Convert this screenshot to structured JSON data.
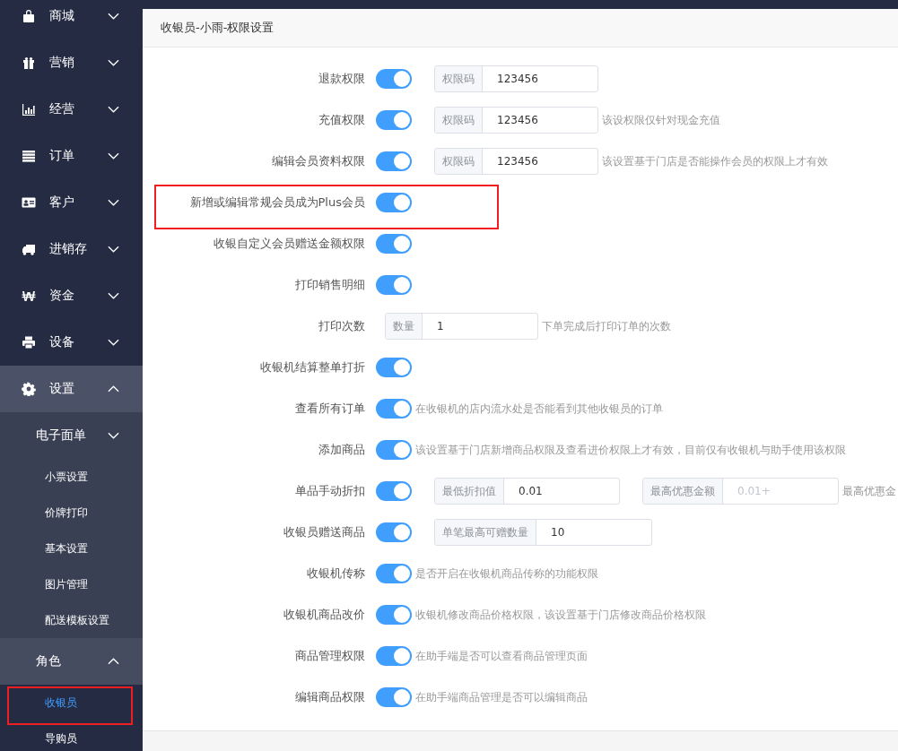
{
  "sidebar": {
    "items": [
      {
        "label": "商城",
        "expanded": false
      },
      {
        "label": "营销",
        "expanded": false
      },
      {
        "label": "经营",
        "expanded": false
      },
      {
        "label": "订单",
        "expanded": false
      },
      {
        "label": "客户",
        "expanded": false
      },
      {
        "label": "进销存",
        "expanded": false
      },
      {
        "label": "资金",
        "expanded": false
      },
      {
        "label": "设备",
        "expanded": false
      },
      {
        "label": "设置",
        "expanded": true,
        "children": [
          {
            "label": "电子面单",
            "expanded": false
          },
          {
            "label": "小票设置",
            "selected": false,
            "highlighted": false
          },
          {
            "label": "价牌打印",
            "selected": false,
            "highlighted": false
          },
          {
            "label": "基本设置",
            "selected": false,
            "highlighted": false
          },
          {
            "label": "图片管理",
            "selected": false,
            "highlighted": false
          },
          {
            "label": "配送模板设置",
            "selected": false,
            "highlighted": false
          },
          {
            "label": "角色",
            "expanded": true,
            "children": [
              {
                "label": "收银员",
                "selected": true,
                "highlighted": true
              },
              {
                "label": "导购员",
                "selected": false,
                "highlighted": false
              }
            ]
          }
        ]
      }
    ]
  },
  "header": {
    "title": "收银员-小雨-权限设置"
  },
  "rows": [
    {
      "kind": "switch",
      "label": "退款权限",
      "on": true,
      "highlighted": false,
      "inputs": [
        {
          "prefix": "权限码",
          "value": "123456"
        }
      ]
    },
    {
      "kind": "switch",
      "label": "充值权限",
      "on": true,
      "highlighted": false,
      "inputs": [
        {
          "prefix": "权限码",
          "value": "123456"
        }
      ],
      "hint": "该设权限仅针对现金充值"
    },
    {
      "kind": "switch",
      "label": "编辑会员资料权限",
      "on": true,
      "highlighted": false,
      "inputs": [
        {
          "prefix": "权限码",
          "value": "123456"
        }
      ],
      "hint": "该设置基于门店是否能操作会员的权限上才有效"
    },
    {
      "kind": "switch",
      "label": "新增或编辑常规会员成为Plus会员",
      "on": true,
      "highlighted": true
    },
    {
      "kind": "switch",
      "label": "收银自定义会员赠送金额权限",
      "on": true,
      "highlighted": false
    },
    {
      "kind": "switch",
      "label": "打印销售明细",
      "on": true,
      "highlighted": false
    },
    {
      "kind": "count",
      "label": "打印次数",
      "highlighted": false,
      "inputs": [
        {
          "prefix": "数量",
          "value": "1"
        }
      ],
      "hint": "下单完成后打印订单的次数"
    },
    {
      "kind": "switch",
      "label": "收银机结算整单打折",
      "on": true,
      "highlighted": false
    },
    {
      "kind": "switch",
      "label": "查看所有订单",
      "on": true,
      "highlighted": false,
      "hint": "在收银机的店内流水处是否能看到其他收银员的订单"
    },
    {
      "kind": "switch",
      "label": "添加商品",
      "on": true,
      "highlighted": false,
      "hint": "该设置基于门店新增商品权限及查看进价权限上才有效，目前仅有收银机与助手使用该权限"
    },
    {
      "kind": "switch",
      "label": "单品手动折扣",
      "on": true,
      "highlighted": false,
      "inputs": [
        {
          "prefix": "最低折扣值",
          "value": "0.01"
        },
        {
          "prefix": "最高优惠金额",
          "placeholder": "0.01+"
        }
      ],
      "hint": "最高优惠金"
    },
    {
      "kind": "switch",
      "label": "收银员赠送商品",
      "on": true,
      "highlighted": false,
      "inputs": [
        {
          "prefix": "单笔最高可赠数量",
          "value": "10"
        }
      ]
    },
    {
      "kind": "switch",
      "label": "收银机传称",
      "on": true,
      "highlighted": false,
      "hint": "是否开启在收银机商品传称的功能权限"
    },
    {
      "kind": "switch",
      "label": "收银机商品改价",
      "on": true,
      "highlighted": false,
      "hint": "收银机修改商品价格权限，该设置基于门店修改商品价格权限"
    },
    {
      "kind": "switch",
      "label": "商品管理权限",
      "on": true,
      "highlighted": false,
      "hint": "在助手端是否可以查看商品管理页面"
    },
    {
      "kind": "switch",
      "label": "编辑商品权限",
      "on": true,
      "highlighted": false,
      "hint": "在助手端商品管理是否可以编辑商品"
    }
  ]
}
